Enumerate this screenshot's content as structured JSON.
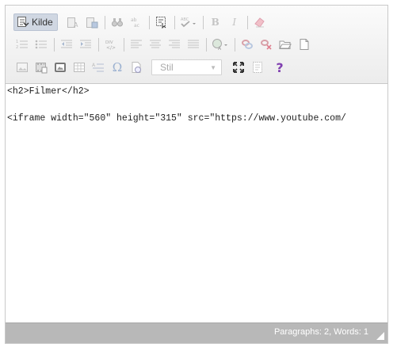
{
  "toolbar": {
    "source_label": "Kilde",
    "style_select_value": "Stil"
  },
  "content": {
    "lines": [
      "<h2>Filmer</h2>",
      "",
      "<iframe width=\"560\" height=\"315\" src=\"https://www.youtube.com/"
    ]
  },
  "status": {
    "counts": "Paragraphs: 2, Words: 1"
  },
  "colors": {
    "accent_help": "#8040b0",
    "active_button_bg": "#d0d7e2",
    "status_bar_bg": "#b8b8b8"
  }
}
